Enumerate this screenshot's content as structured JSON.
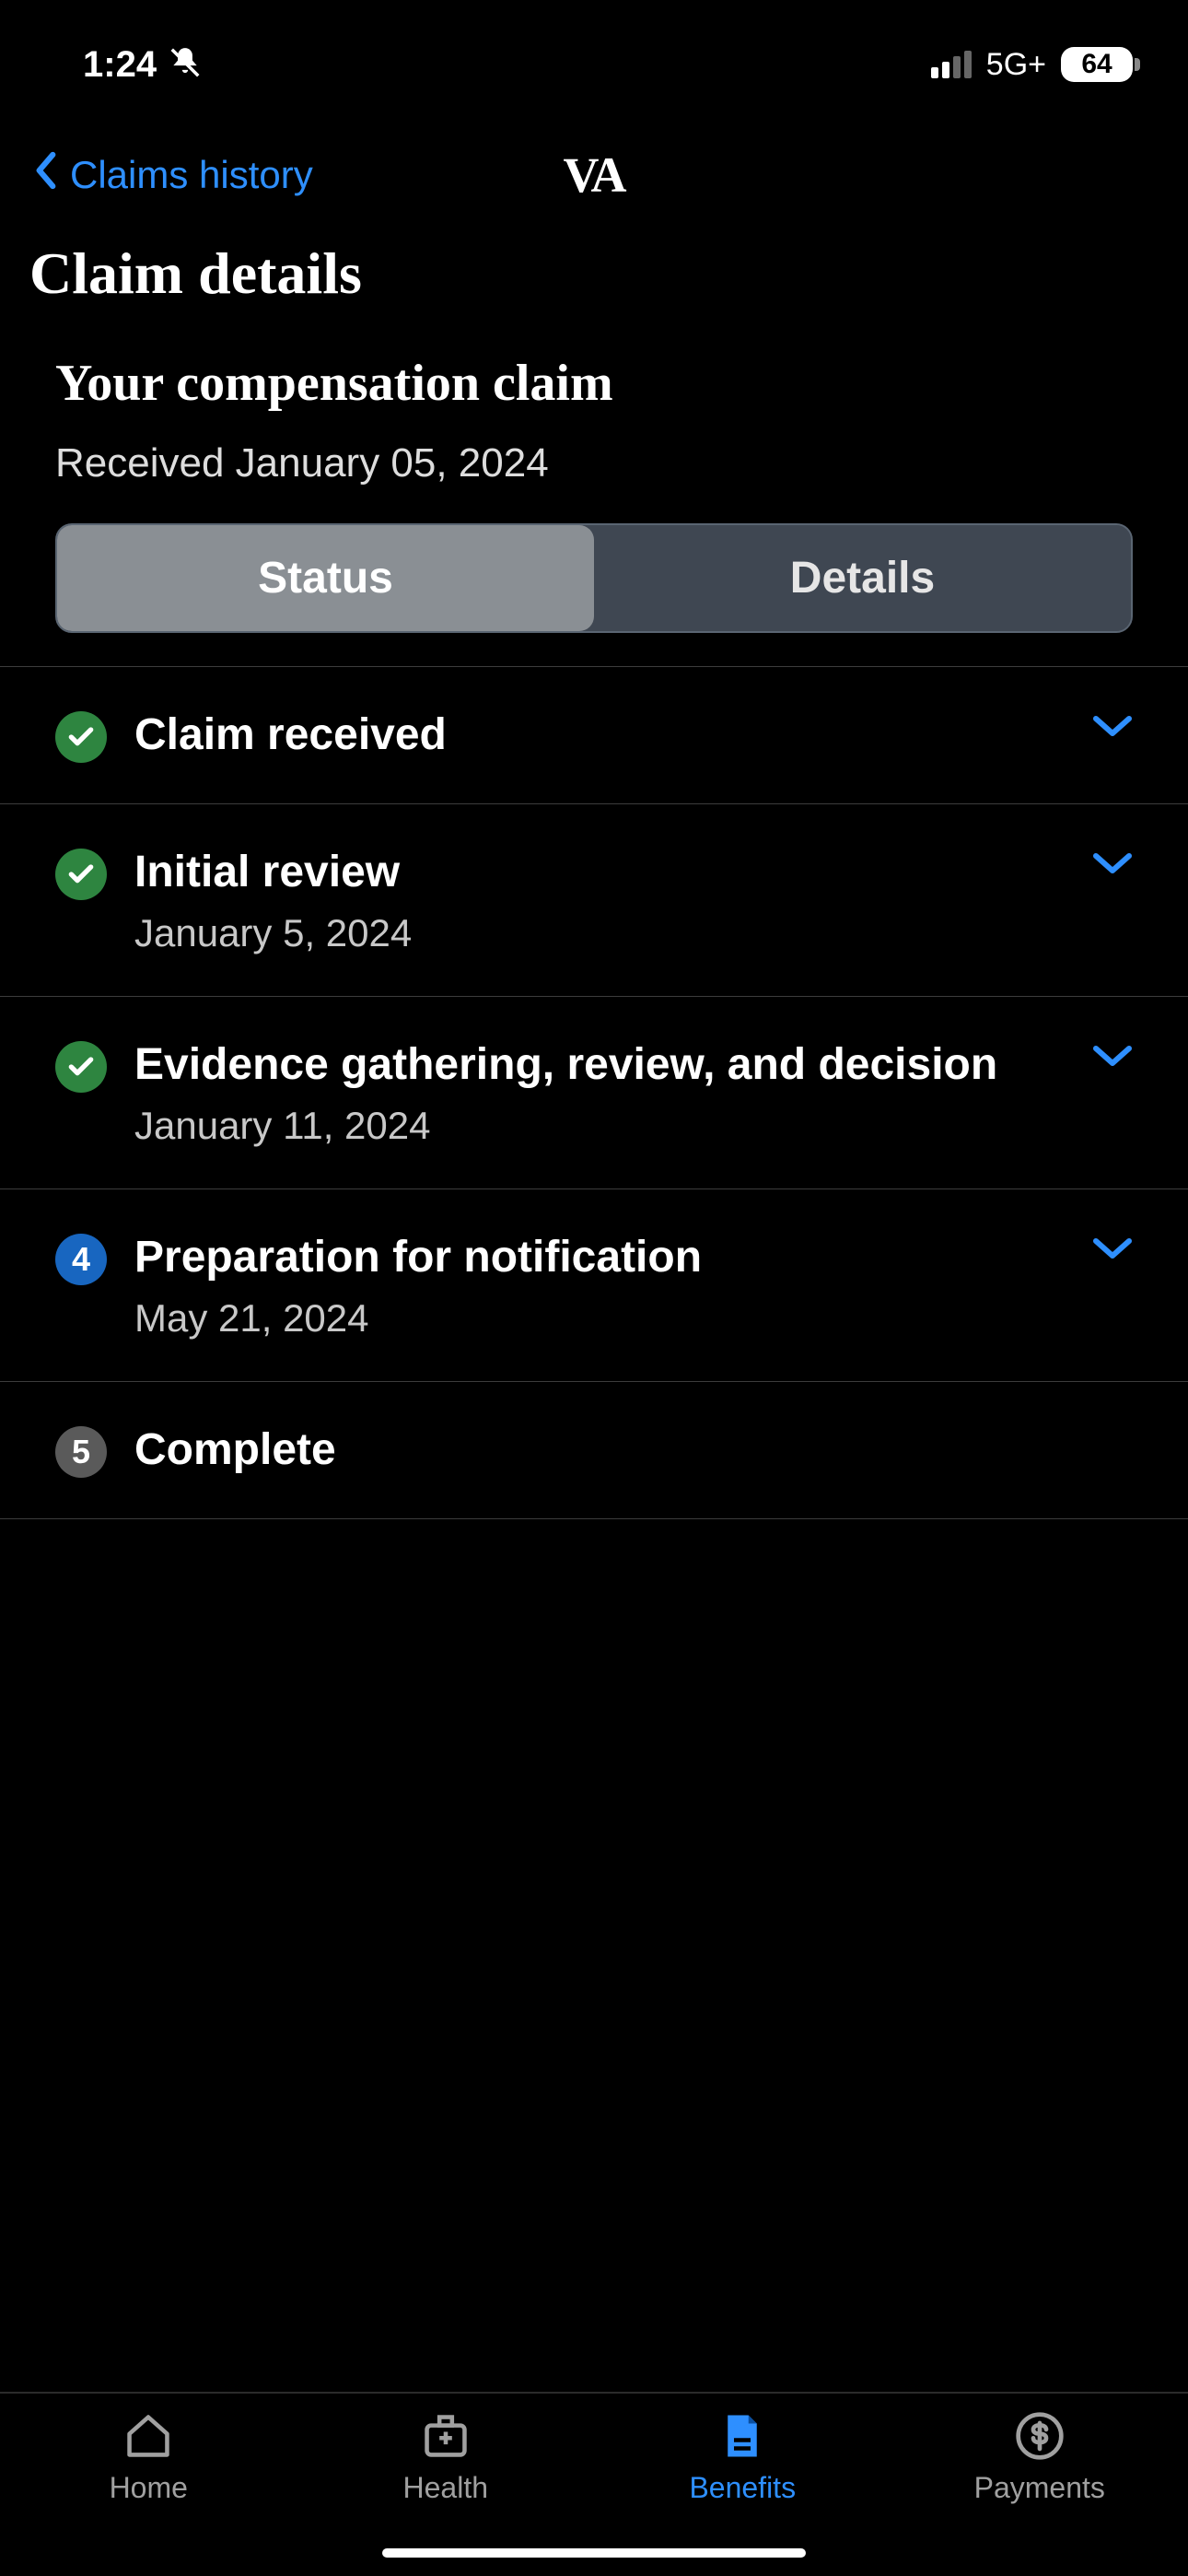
{
  "status_bar": {
    "time": "1:24",
    "network": "5G+",
    "battery": "64"
  },
  "header": {
    "back_label": "Claims history",
    "brand": "VA"
  },
  "page": {
    "title": "Claim details",
    "heading": "Your compensation claim",
    "received_line": "Received January 05, 2024"
  },
  "tabs": {
    "status_label": "Status",
    "details_label": "Details"
  },
  "steps": [
    {
      "title": "Claim received",
      "date": "",
      "state": "done"
    },
    {
      "title": "Initial review",
      "date": "January 5, 2024",
      "state": "done"
    },
    {
      "title": "Evidence gathering, review, and decision",
      "date": "January 11, 2024",
      "state": "done"
    },
    {
      "title": "Preparation for notification",
      "date": "May 21, 2024",
      "state": "current",
      "num": "4"
    },
    {
      "title": "Complete",
      "date": "",
      "state": "future",
      "num": "5"
    }
  ],
  "tabbar": {
    "home": "Home",
    "health": "Health",
    "benefits": "Benefits",
    "payments": "Payments"
  },
  "colors": {
    "link_blue": "#2E8FFF",
    "done_green": "#2E8540",
    "current_blue": "#1866C0"
  }
}
